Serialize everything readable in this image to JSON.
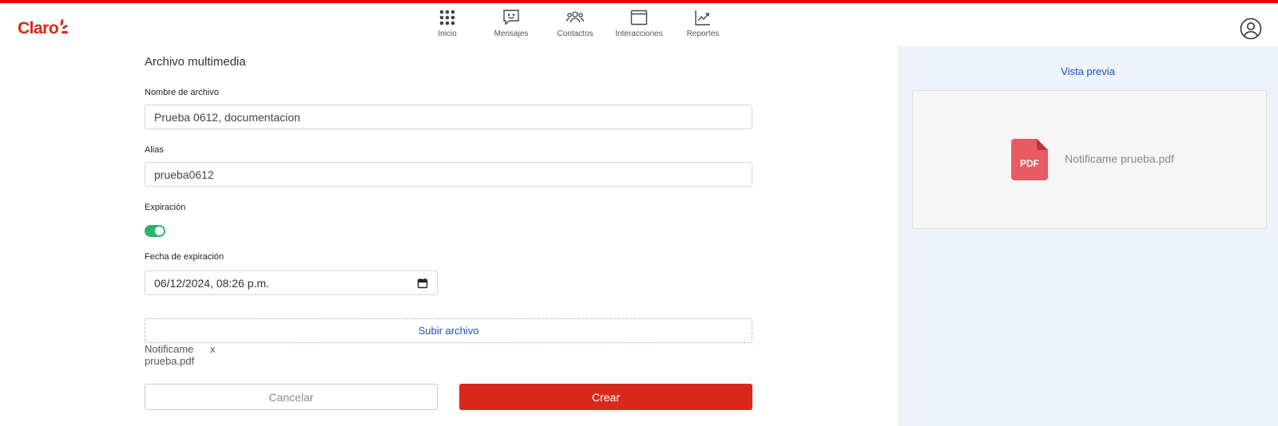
{
  "brand": {
    "logo_text": "Claro"
  },
  "nav": {
    "items": [
      {
        "label": "Inicio",
        "icon": "apps-grid-icon"
      },
      {
        "label": "Mensajes",
        "icon": "message-smile-icon"
      },
      {
        "label": "Contactos",
        "icon": "users-group-icon"
      },
      {
        "label": "Interacciones",
        "icon": "window-icon"
      },
      {
        "label": "Reportes",
        "icon": "chart-trend-icon"
      }
    ]
  },
  "form": {
    "title": "Archivo multimedia",
    "filename_label": "Nombre de archivo",
    "filename_value": "Prueba 0612, documentacion",
    "alias_label": "Alias",
    "alias_value": "prueba0612",
    "expiration_label": "Expiración",
    "expiration_enabled": true,
    "expiration_date_label": "Fecha de expiración",
    "expiration_date_value": "06/12/2024, 08:26 p.m.",
    "upload_label": "Subir archivo",
    "uploaded_file": "Notificame prueba.pdf",
    "remove_label": "x",
    "cancel_label": "Cancelar",
    "create_label": "Crear"
  },
  "preview": {
    "title": "Vista previa",
    "file_type": "PDF",
    "file_name": "Notificame prueba.pdf"
  },
  "colors": {
    "brand_red": "#e1251b",
    "create_button": "#da291c",
    "toggle_on": "#2db36a",
    "link_blue": "#1f4fbf",
    "panel_bg": "#edf2fb"
  }
}
